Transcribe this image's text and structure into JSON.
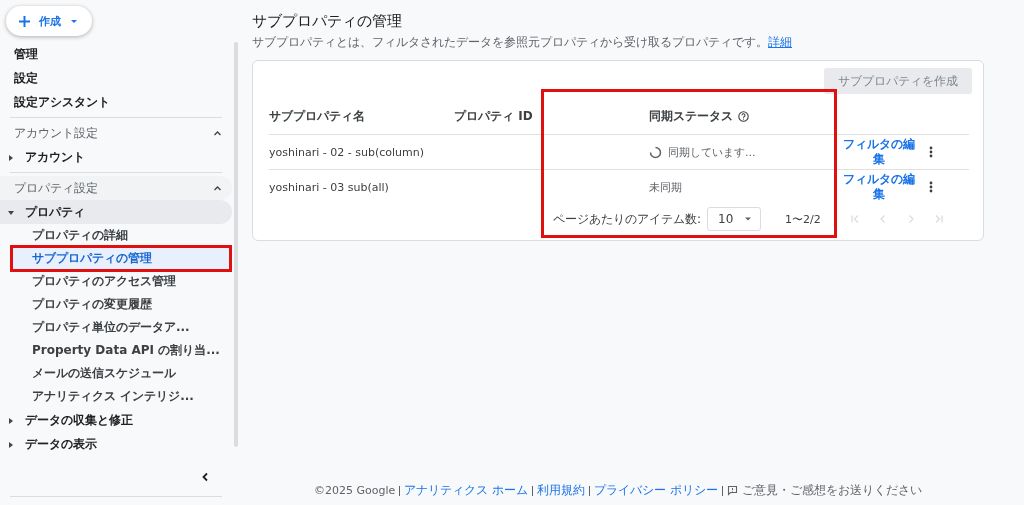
{
  "create_button": {
    "label": "作成"
  },
  "sidebar": {
    "top_items": [
      {
        "label": "管理"
      },
      {
        "label": "設定"
      },
      {
        "label": "設定アシスタント"
      }
    ],
    "sections": [
      {
        "title": "アカウント設定",
        "expanded": true,
        "items": [
          {
            "label": "アカウント",
            "expanded": false
          }
        ]
      },
      {
        "title": "プロパティ設定",
        "expanded": true,
        "items": [
          {
            "label": "プロパティ",
            "expanded": true,
            "children": [
              {
                "label": "プロパティの詳細",
                "selected": false,
                "highlighted": false
              },
              {
                "label": "サブプロパティの管理",
                "selected": true,
                "highlighted": true
              },
              {
                "label": "プロパティのアクセス管理",
                "selected": false,
                "highlighted": false
              },
              {
                "label": "プロパティの変更履歴",
                "selected": false,
                "highlighted": false
              },
              {
                "label": "プロパティ単位のデータア...",
                "selected": false,
                "highlighted": false
              },
              {
                "label": "Property Data API の割り当...",
                "selected": false,
                "highlighted": false
              },
              {
                "label": "メールの送信スケジュール",
                "selected": false,
                "highlighted": false
              },
              {
                "label": "アナリティクス インテリジ...",
                "selected": false,
                "highlighted": false
              }
            ]
          },
          {
            "label": "データの収集と修正",
            "expanded": false
          },
          {
            "label": "データの表示",
            "expanded": false
          }
        ]
      }
    ]
  },
  "page": {
    "title": "サブプロパティの管理",
    "description": "サブプロパティとは、フィルタされたデータを参照元プロパティから受け取るプロパティです。",
    "learn_more": "詳細"
  },
  "table": {
    "create_button": {
      "label": "サブプロパティを作成",
      "disabled": true
    },
    "columns": [
      {
        "label": "サブプロパティ名",
        "help": false,
        "highlighted": false
      },
      {
        "label": "プロパティ ID",
        "help": false,
        "highlighted": false
      },
      {
        "label": "同期ステータス",
        "help": true,
        "highlighted": true
      }
    ],
    "rows": [
      {
        "name": "yoshinari - 02 - sub(column)",
        "status": "同期しています...",
        "syncing": true,
        "action": "フィルタの編集"
      },
      {
        "name": "yoshinari - 03 sub(all)",
        "status": "未同期",
        "syncing": false,
        "action": "フィルタの編集"
      }
    ],
    "pagination": {
      "label": "ページあたりのアイテム数:",
      "page_size": "10",
      "range": "1〜2/2"
    }
  },
  "footer": {
    "copyright": "©2025 Google",
    "links": [
      "アナリティクス ホーム",
      "利用規約",
      "プライバシー ポリシー"
    ],
    "feedback": "ご意見・ご感想をお送りください"
  }
}
